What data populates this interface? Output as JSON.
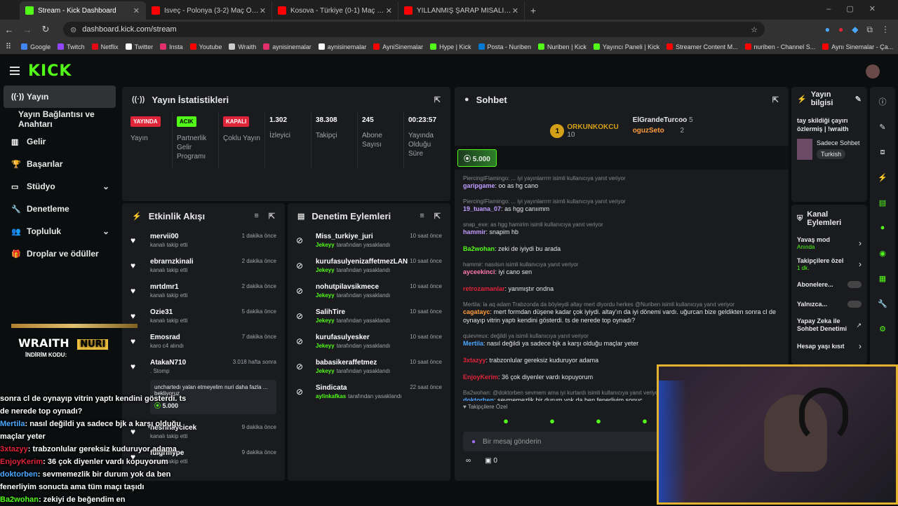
{
  "browser": {
    "tabs": [
      {
        "label": "Stream - Kick Dashboard",
        "color": "#53fc18",
        "active": true
      },
      {
        "label": "İsveç - Polonya (3-2) Maç Özeti",
        "color": "#ff0000"
      },
      {
        "label": "Kosova - Türkiye (0-1) Maç Öze",
        "color": "#ff0000"
      },
      {
        "label": "YILLANMIŞ ŞARAP MİSALİ.. | LC",
        "color": "#ff0000"
      }
    ],
    "url": "dashboard.kick.com/stream",
    "bookmarks": [
      {
        "label": "Google",
        "color": "#4285f4"
      },
      {
        "label": "Twitch",
        "color": "#9146ff"
      },
      {
        "label": "Netflix",
        "color": "#e50914"
      },
      {
        "label": "Twitter",
        "color": "#ffffff"
      },
      {
        "label": "Insta",
        "color": "#e1306c"
      },
      {
        "label": "Youtube",
        "color": "#ff0000"
      },
      {
        "label": "Wraith",
        "color": "#cccccc"
      },
      {
        "label": "aynisinemalar",
        "color": "#e1306c"
      },
      {
        "label": "aynisinemalar",
        "color": "#ffffff"
      },
      {
        "label": "AyniSinemalar",
        "color": "#ff0000"
      },
      {
        "label": "Hype | Kick",
        "color": "#53fc18"
      },
      {
        "label": "Posta - Nuriben",
        "color": "#0078d4"
      },
      {
        "label": "Nuriben | Kick",
        "color": "#53fc18"
      },
      {
        "label": "Yayıncı Paneli | Kick",
        "color": "#53fc18"
      },
      {
        "label": "Streamer Content M...",
        "color": "#ff0000"
      },
      {
        "label": "nuriben - Channel S...",
        "color": "#ff0000"
      },
      {
        "label": "Aynı Sinemalar - Ça...",
        "color": "#ff0000"
      }
    ]
  },
  "brand": {
    "logo": "KICK",
    "accent": "#53fc18"
  },
  "sidebar": {
    "items": [
      {
        "label": "Yayın",
        "icon": "broadcast-icon",
        "active": true
      },
      {
        "label": "Yayın Bağlantısı ve Anahtarı",
        "icon": ""
      },
      {
        "label": "Gelir",
        "icon": "chart-icon"
      },
      {
        "label": "Başarılar",
        "icon": "trophy-icon"
      },
      {
        "label": "Stüdyo",
        "icon": "studio-icon",
        "chevron": true
      },
      {
        "label": "Denetleme",
        "icon": "wrench-icon"
      },
      {
        "label": "Topluluk",
        "icon": "community-icon",
        "chevron": true
      },
      {
        "label": "Droplar ve ödüller",
        "icon": "gift-icon"
      }
    ]
  },
  "stats": {
    "title": "Yayın İstatistikleri",
    "items": [
      {
        "badge": "YAYINDA",
        "badge_color": "#e0243a",
        "label": "Yayın"
      },
      {
        "badge": "ACIK",
        "badge_color": "#53fc18",
        "label": "Partnerlik Gelir Programı"
      },
      {
        "badge": "KAPALI",
        "badge_color": "#e0243a",
        "label": "Çoklu Yayın"
      },
      {
        "value": "1.302",
        "label": "İzleyici"
      },
      {
        "value": "38.308",
        "label": "Takipçi"
      },
      {
        "value": "245",
        "label": "Abone Sayısı"
      },
      {
        "value": "00:23:57",
        "label": "Yayında Olduğu Süre"
      }
    ]
  },
  "activity": {
    "title": "Etkinlik Akışı",
    "items": [
      {
        "user": "mervii00",
        "action": "kanalı takip etti",
        "time": "1 dakika önce"
      },
      {
        "user": "ebrarnzkinali",
        "action": "kanalı takip etti",
        "time": "2 dakika önce"
      },
      {
        "user": "mrtdmr1",
        "action": "kanalı takip etti",
        "time": "2 dakika önce"
      },
      {
        "user": "Ozie31",
        "action": "kanalı takip etti",
        "time": "5 dakika önce"
      },
      {
        "user": "Emosrad",
        "action": "karo c4 alındı",
        "time": "7 dakika önce"
      },
      {
        "user": "AtakaN710",
        "action": ". Stomp",
        "time": "3.018 hafta sonra"
      }
    ],
    "note": "unchartedı yalan etmeyelim nuri daha fazla ... bekliyoruz",
    "note_amount": "5.000",
    "items2": [
      {
        "user": "nesrinaycicek",
        "action": "kanalı takip etti",
        "time": "9 dakika önce"
      },
      {
        "user": "fulgrmype",
        "action": "kanalı takip etti",
        "time": "9 dakika önce"
      }
    ]
  },
  "moderation": {
    "title": "Denetim Eylemleri",
    "items": [
      {
        "user": "Miss_turkiye_juri",
        "by": "Jekeyy",
        "suffix": "tarafından yasaklandı",
        "time": "10 saat önce"
      },
      {
        "user": "kurufasulyenizaffetmezLAN",
        "by": "Jekeyy",
        "suffix": "tarafından yasaklandı",
        "time": "10 saat önce"
      },
      {
        "user": "nohutpilavsikmece",
        "by": "Jekeyy",
        "suffix": "tarafından yasaklandı",
        "time": "10 saat önce"
      },
      {
        "user": "SalihTire",
        "by": "Jekeyy",
        "suffix": "tarafından yasaklandı",
        "time": "10 saat önce"
      },
      {
        "user": "kurufasulyesker",
        "by": "Jekeyy",
        "suffix": "tarafından yasaklandı",
        "time": "10 saat önce"
      },
      {
        "user": "babasikeraffetmez",
        "by": "Jekeyy",
        "suffix": "tarafından yasaklandı",
        "time": "10 saat önce"
      },
      {
        "user": "Sindicata",
        "by": "aylinkafkas",
        "suffix": "tarafından yasaklandı",
        "time": "22 saat önce"
      }
    ]
  },
  "chat": {
    "title": "Sohbet",
    "leader1": {
      "name": "ORKUNKOKCU",
      "count": "10"
    },
    "leader2": {
      "name": "ElGrandeTurcoo",
      "count": "5"
    },
    "leader3": {
      "name": "oguzSeto",
      "count": "2"
    },
    "pinned_amount": "5.000",
    "messages": [
      {
        "reply": "PiercingIFlamingo: ... iyi yayınlarrrrr isimli kullanıcıya yanıt veriyor",
        "user": "garipgame",
        "color": "#c09cff",
        "text": "oo as hg cano"
      },
      {
        "reply": "PiercingIFlamingo: ... iyi yayınlarrrrr isimli kullanıcıya yanıt veriyor",
        "user": "19_tuana_07",
        "color": "#c09cff",
        "text": "as hgg canıımm"
      },
      {
        "reply": "snap_exe: as hgg hamirim isimli kullanıcıya yanıt veriyor",
        "user": "hammir",
        "color": "#c09cff",
        "text": "snapim hb"
      },
      {
        "reply": "",
        "user": "Ba2wohan",
        "color": "#53fc18",
        "text": "zeki de iyiydi bu arada"
      },
      {
        "reply": "hammir: nasılsın isimli kullanıcıya yanıt veriyor",
        "user": "ayceekinci",
        "color": "#ff7ab0",
        "text": "iyi cano sen"
      },
      {
        "reply": "",
        "user": "retrozamanlar",
        "color": "#e0243a",
        "text": "yanmıştır ondna"
      },
      {
        "reply": "Mertila: la aq adam Trabzonda da böyleydi altay mert diyordu herkes @Nuriben isimli kullanıcıya yanıt veriyor",
        "user": "cagatayc",
        "color": "#ff9c3a",
        "text": "mert formdan düşene kadar çok iyiydi. altay'ın da iyi dönemi vardı. uğurcan bize geldikten sonra cl de oynayıp vitrin yaptı kendini gösterdi. ts de nerede top oynadı?"
      },
      {
        "reply": "quievreux: değildi ya isimli kullanıcıya yanıt veriyor",
        "user": "Mertila",
        "color": "#4aa8ff",
        "text": "nasıl değildi ya sadece bjk a karşı olduğu maçlar yeter"
      },
      {
        "reply": "",
        "user": "3xtazyy",
        "color": "#e0243a",
        "text": "trabzonlular gereksiz kuduruyor adama"
      },
      {
        "reply": "",
        "user": "EnjoyKerim",
        "color": "#e0243a",
        "text": "36 çok diyenler vardı kopuyorum"
      },
      {
        "reply": "Ba2wohan: @doktorben sevmem ama iyi kurtardı isimli kullanıcıya yanıt veriyor",
        "user": "doktorben",
        "color": "#4aa8ff",
        "text": "sevmemezlik bir durum yok da ben fenerliyim sonuç"
      },
      {
        "reply": "",
        "user": "Ba2wohan",
        "color": "#53fc18",
        "text": "zekiyi de beğendim en"
      }
    ],
    "follower_only": "Takipçilere Özel",
    "input_placeholder": "Bir mesaj gönderin",
    "footer_count": "0"
  },
  "stream_info": {
    "title": "Yayın bilgisi",
    "stream_title": "tay skildiği çayırı özlermiş | !wraith",
    "category": "Sadece Sohbet",
    "tag": "Turkish"
  },
  "channel_actions": {
    "title": "Kanal Eylemleri",
    "items": [
      {
        "label": "Yavaş mod",
        "sub": "Anında",
        "type": "chevron"
      },
      {
        "label": "Takipçilere özel",
        "sub": "1 dk.",
        "type": "chevron"
      },
      {
        "label": "Abonelere...",
        "sub": "",
        "type": "toggle"
      },
      {
        "label": "Yalnızca...",
        "sub": "",
        "type": "toggle"
      },
      {
        "label": "Yapay Zeka ile Sohbet Denetimi",
        "sub": "",
        "type": "link"
      },
      {
        "label": "Hesap yaşı kısıt",
        "sub": "",
        "type": "chevron"
      }
    ]
  },
  "overlay": {
    "promo_brand": "WRAITH",
    "promo_code_label": "İNDİRİM KODU:",
    "promo_code": "NURI",
    "lines": [
      {
        "user": "",
        "color": "#ffffff",
        "text": "sonra cl de oynayıp vitrin yaptı kendini gösterdi. ts de nerede top oynadı?"
      },
      {
        "user": "Mertila",
        "color": "#4aa8ff",
        "text": ": nasıl değildi ya sadece bjk a karşı olduğu maçlar yeter"
      },
      {
        "user": "3xtazyy",
        "color": "#e0243a",
        "text": ": trabzonlular gereksiz kuduruyor adama"
      },
      {
        "user": "EnjoyKerim",
        "color": "#e0243a",
        "text": ": 36 çok diyenler vardı kopuyorum"
      },
      {
        "user": "doktorben",
        "color": "#4aa8ff",
        "text": ": sevmemezlik bir durum yok da ben fenerliyim sonucta ama tüm maçı taşıdı"
      },
      {
        "user": "Ba2wohan",
        "color": "#53fc18",
        "text": ": zekiyi de beğendim en"
      }
    ]
  }
}
